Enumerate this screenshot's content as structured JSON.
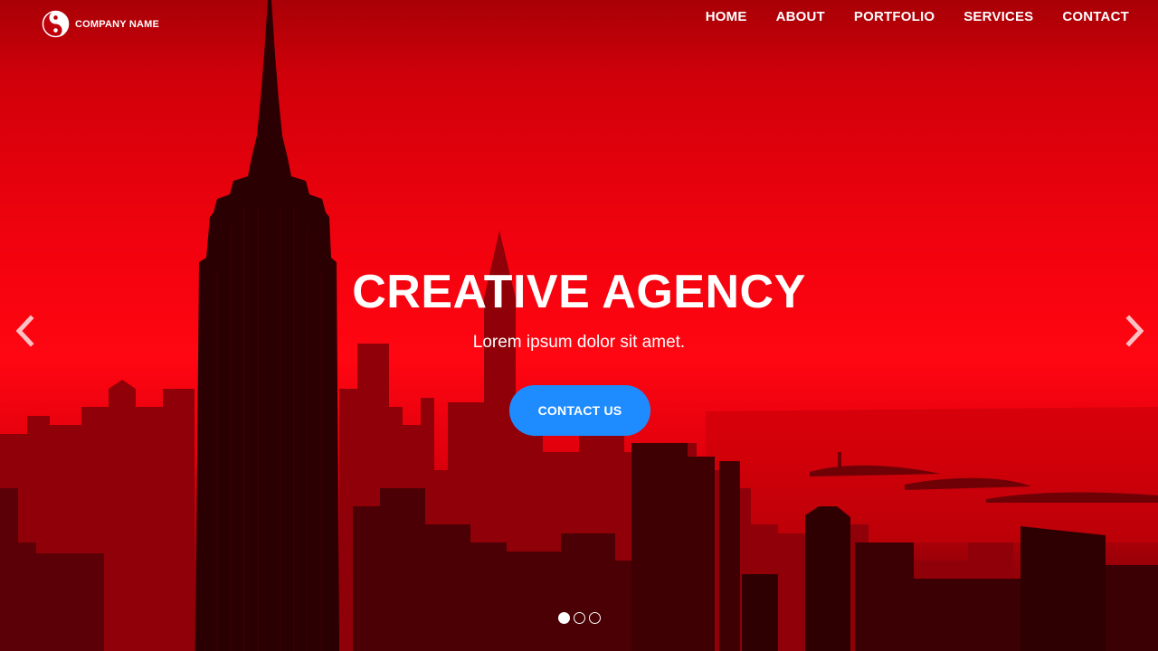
{
  "header": {
    "logo_text": "COMPANY NAME",
    "logo_icon": "yin-yang-icon",
    "nav": [
      {
        "label": "HOME"
      },
      {
        "label": "ABOUT"
      },
      {
        "label": "PORTFOLIO"
      },
      {
        "label": "SERVICES"
      },
      {
        "label": "CONTACT"
      }
    ]
  },
  "hero": {
    "title": "CREATIVE AGENCY",
    "subtitle": "Lorem ipsum dolor sit amet.",
    "cta_label": "CONTACT US",
    "background": "city-skyline-red-tint"
  },
  "carousel": {
    "prev_icon": "chevron-left-icon",
    "next_icon": "chevron-right-icon",
    "slides": 3,
    "active_slide": 1
  },
  "colors": {
    "accent": "#1e8cff",
    "hero_tint": "#ff0612",
    "text": "#ffffff"
  }
}
